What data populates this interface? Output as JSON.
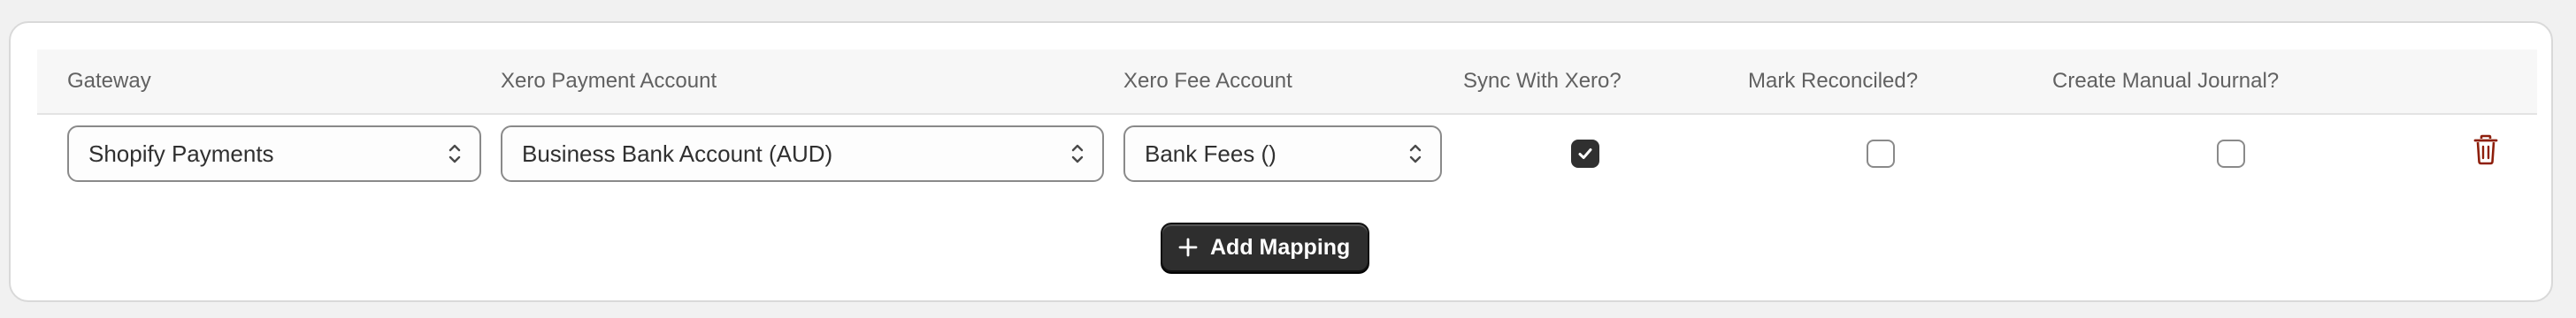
{
  "table": {
    "headers": {
      "gateway": "Gateway",
      "payment_account": "Xero Payment Account",
      "fee_account": "Xero Fee Account",
      "sync": "Sync With Xero?",
      "reconciled": "Mark Reconciled?",
      "journal": "Create Manual Journal?"
    },
    "rows": [
      {
        "gateway": "Shopify Payments",
        "payment_account": "Business Bank Account (AUD)",
        "fee_account": "Bank Fees ()",
        "sync": true,
        "reconciled": false,
        "journal": false
      }
    ]
  },
  "actions": {
    "add_mapping_label": "Add Mapping"
  },
  "icons": {
    "select_chevron": "chevron-up-down-icon",
    "delete": "trash-icon",
    "add": "plus-icon",
    "check": "checkmark-icon"
  },
  "colors": {
    "delete_icon": "#8e1f0b",
    "button_bg": "#2e2e2e",
    "checkbox_on": "#303030"
  }
}
